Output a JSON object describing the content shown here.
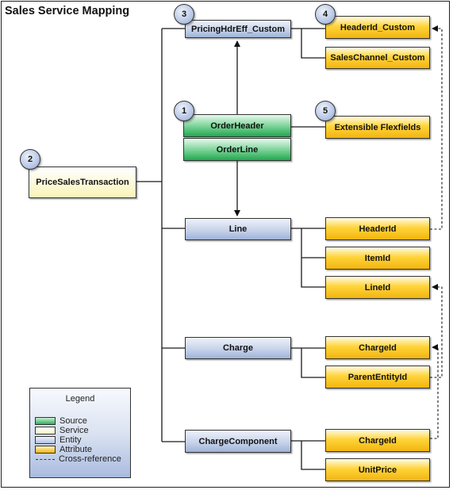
{
  "title": "Sales Service Mapping",
  "colors": {
    "source": "#3cb464",
    "service": "#fbf6c8",
    "entity": "#b9c8e6",
    "attribute": "#ffcc22",
    "badge": "#b9c8e6",
    "line": "#222222"
  },
  "badges": {
    "b1": "1",
    "b2": "2",
    "b3": "3",
    "b4": "4",
    "b5": "5"
  },
  "nodes": {
    "order_header": {
      "label": "OrderHeader",
      "type": "Source"
    },
    "order_line": {
      "label": "OrderLine",
      "type": "Source"
    },
    "price_sales_transaction": {
      "label": "PriceSalesTransaction",
      "type": "Service"
    },
    "pricing_hdr_eff_custom": {
      "label": "PricingHdrEff_Custom",
      "type": "Entity"
    },
    "line": {
      "label": "Line",
      "type": "Entity"
    },
    "charge": {
      "label": "Charge",
      "type": "Entity"
    },
    "charge_component": {
      "label": "ChargeComponent",
      "type": "Entity"
    },
    "header_id_custom": {
      "label": "HeaderId_Custom",
      "type": "Attribute"
    },
    "sales_channel_custom": {
      "label": "SalesChannel_Custom",
      "type": "Attribute"
    },
    "extensible_flexfields": {
      "label": "Extensible Flexfields",
      "type": "Attribute"
    },
    "line_header_id": {
      "label": "HeaderId",
      "type": "Attribute"
    },
    "line_item_id": {
      "label": "ItemId",
      "type": "Attribute"
    },
    "line_line_id": {
      "label": "LineId",
      "type": "Attribute"
    },
    "charge_charge_id": {
      "label": "ChargeId",
      "type": "Attribute"
    },
    "charge_parent_entity_id": {
      "label": "ParentEntityId",
      "type": "Attribute"
    },
    "component_charge_id": {
      "label": "ChargeId",
      "type": "Attribute"
    },
    "component_unit_price": {
      "label": "UnitPrice",
      "type": "Attribute"
    }
  },
  "edges": [
    {
      "from": "PriceSalesTransaction",
      "to": "PricingHdrEff_Custom",
      "style": "solid"
    },
    {
      "from": "PriceSalesTransaction",
      "to": "Line",
      "style": "solid"
    },
    {
      "from": "PriceSalesTransaction",
      "to": "Charge",
      "style": "solid"
    },
    {
      "from": "PriceSalesTransaction",
      "to": "ChargeComponent",
      "style": "solid"
    },
    {
      "from": "OrderHeader",
      "to": "PricingHdrEff_Custom",
      "style": "arrow"
    },
    {
      "from": "OrderLine",
      "to": "Line",
      "style": "arrow"
    },
    {
      "from": "OrderHeader",
      "to": "Extensible Flexfields",
      "style": "solid"
    },
    {
      "from": "PricingHdrEff_Custom",
      "to": "HeaderId_Custom",
      "style": "solid"
    },
    {
      "from": "PricingHdrEff_Custom",
      "to": "SalesChannel_Custom",
      "style": "solid"
    },
    {
      "from": "Line",
      "to": "HeaderId",
      "style": "solid"
    },
    {
      "from": "Line",
      "to": "ItemId",
      "style": "solid"
    },
    {
      "from": "Line",
      "to": "LineId",
      "style": "solid"
    },
    {
      "from": "Charge",
      "to": "ChargeId",
      "style": "solid"
    },
    {
      "from": "Charge",
      "to": "ParentEntityId",
      "style": "solid"
    },
    {
      "from": "ChargeComponent",
      "to": "ChargeId",
      "style": "solid"
    },
    {
      "from": "ChargeComponent",
      "to": "UnitPrice",
      "style": "solid"
    },
    {
      "from": "HeaderId",
      "to": "HeaderId_Custom",
      "style": "cross-reference"
    },
    {
      "from": "ParentEntityId",
      "to": "LineId",
      "style": "cross-reference"
    },
    {
      "from": "ChargeComponent.ChargeId",
      "to": "Charge.ChargeId",
      "style": "cross-reference"
    }
  ],
  "legend": {
    "title": "Legend",
    "items": [
      {
        "label": "Source"
      },
      {
        "label": "Service"
      },
      {
        "label": "Entity"
      },
      {
        "label": "Attribute"
      },
      {
        "label": "Cross-reference"
      }
    ]
  }
}
